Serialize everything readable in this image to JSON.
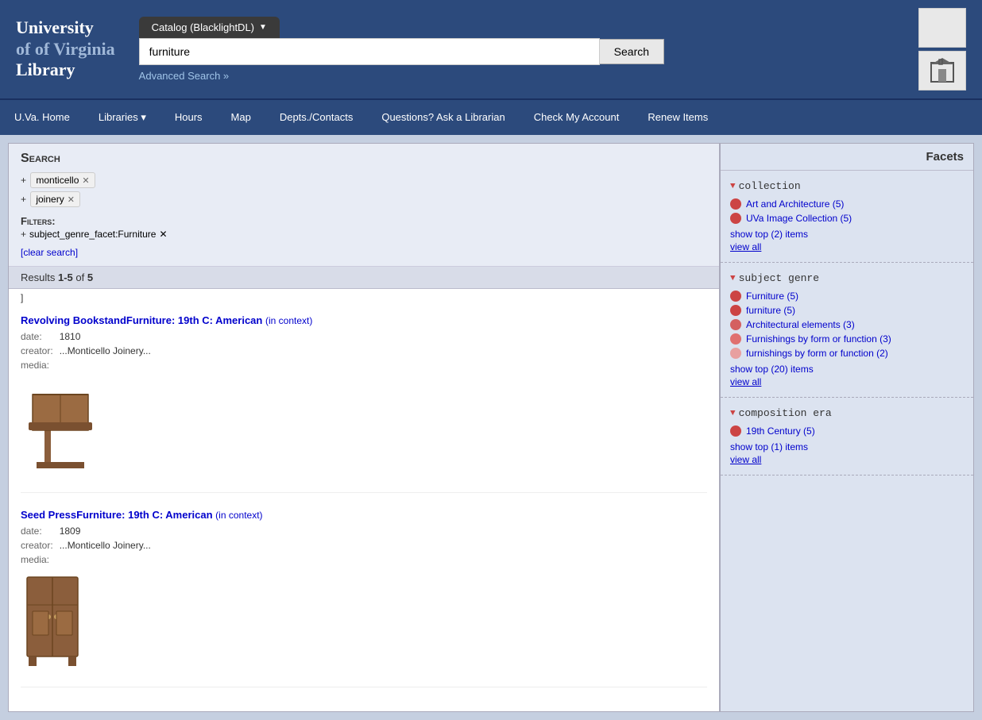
{
  "header": {
    "logo_line1": "University",
    "logo_line2": "of Virginia",
    "logo_line3": "Library",
    "catalog_tab": "Catalog (BlacklightDL)",
    "search_value": "furniture",
    "search_button": "Search",
    "advanced_search": "Advanced Search »"
  },
  "nav": {
    "items": [
      {
        "label": "U.Va. Home",
        "id": "uva-home",
        "dropdown": false
      },
      {
        "label": "Libraries",
        "id": "libraries",
        "dropdown": true
      },
      {
        "label": "Hours",
        "id": "hours",
        "dropdown": false
      },
      {
        "label": "Map",
        "id": "map",
        "dropdown": false
      },
      {
        "label": "Depts./Contacts",
        "id": "depts",
        "dropdown": false
      },
      {
        "label": "Questions? Ask a Librarian",
        "id": "ask",
        "dropdown": false
      },
      {
        "label": "Check My Account",
        "id": "account",
        "dropdown": false
      },
      {
        "label": "Renew Items",
        "id": "renew",
        "dropdown": false
      }
    ]
  },
  "search_panel": {
    "title": "Search",
    "tags": [
      {
        "label": "monticello",
        "id": "tag-monticello"
      },
      {
        "label": "joinery",
        "id": "tag-joinery"
      }
    ],
    "filters_label": "Filters:",
    "filter_items": [
      {
        "label": "subject_genre_facet:Furniture",
        "id": "filter-furniture"
      }
    ],
    "clear_search": "[clear search]",
    "results_label": "Results",
    "results_range": "1-5",
    "results_of": "of",
    "results_total": "5"
  },
  "results": [
    {
      "id": "result-1",
      "title": "Revolving BookstandFurniture: 19th C: American",
      "in_context": "(in context)",
      "date_label": "date:",
      "date_value": "1810",
      "creator_label": "creator:",
      "creator_value": "...Monticello Joinery...",
      "media_label": "media:",
      "media_value": ""
    },
    {
      "id": "result-2",
      "title": "Seed PressFurniture: 19th C: American",
      "in_context": "(in context)",
      "date_label": "date:",
      "date_value": "1809",
      "creator_label": "creator:",
      "creator_value": "...Monticello Joinery...",
      "media_label": "media:",
      "media_value": ""
    }
  ],
  "facets": {
    "title": "Facets",
    "sections": [
      {
        "id": "collection",
        "heading": "collection",
        "items": [
          {
            "label": "Art and Architecture (5)",
            "dot": "dark"
          },
          {
            "label": "UVa Image Collection (5)",
            "dot": "dark"
          }
        ],
        "show_top": "show top (2) items",
        "view_all": "view all"
      },
      {
        "id": "subject-genre",
        "heading": "subject genre",
        "items": [
          {
            "label": "Furniture (5)",
            "dot": "dark"
          },
          {
            "label": "furniture (5)",
            "dot": "dark"
          },
          {
            "label": "Architectural elements (3)",
            "dot": "medium"
          },
          {
            "label": "Furnishings by form or function (3)",
            "dot": "light"
          },
          {
            "label": "furnishings by form or function (2)",
            "dot": "lighter"
          }
        ],
        "show_top": "show top (20) items",
        "view_all": "view all"
      },
      {
        "id": "composition-era",
        "heading": "composition era",
        "items": [
          {
            "label": "19th Century (5)",
            "dot": "dark"
          }
        ],
        "show_top": "show top (1) items",
        "view_all": "view all"
      }
    ]
  }
}
